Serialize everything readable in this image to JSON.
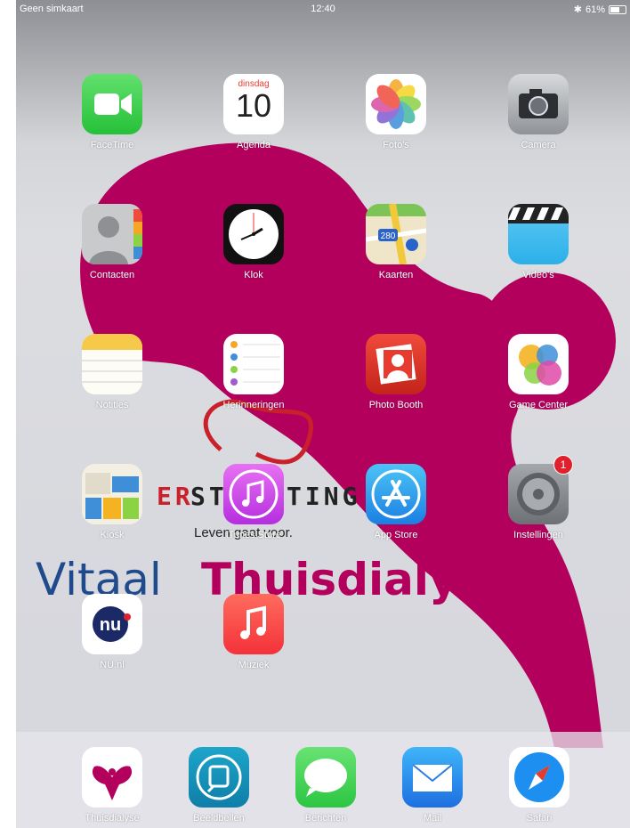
{
  "status_bar": {
    "carrier": "Geen simkaart",
    "time": "12:40",
    "battery": "61%"
  },
  "wallpaper": {
    "logo_word_left": "ER",
    "logo_word_mid": "ST",
    "logo_word_right": "TING",
    "slogan": "Leven gaat voor.",
    "headline_part1": "Vitaal",
    "headline_part2": "Thuisdialyse",
    "colors": {
      "magenta": "#b4005d",
      "blue": "#1f4a8c"
    }
  },
  "apps": [
    {
      "label": "FaceTime",
      "icon": "facetime-icon"
    },
    {
      "label": "Agenda",
      "icon": "calendar-icon",
      "day": "dinsdag",
      "date": "10"
    },
    {
      "label": "Foto's",
      "icon": "photos-icon"
    },
    {
      "label": "Camera",
      "icon": "camera-icon"
    },
    {
      "label": "Contacten",
      "icon": "contacts-icon"
    },
    {
      "label": "Klok",
      "icon": "clock-icon"
    },
    {
      "label": "Kaarten",
      "icon": "maps-icon",
      "sign": "280"
    },
    {
      "label": "Video's",
      "icon": "videos-icon"
    },
    {
      "label": "Notities",
      "icon": "notes-icon"
    },
    {
      "label": "Herinneringen",
      "icon": "reminders-icon"
    },
    {
      "label": "Photo Booth",
      "icon": "photo-booth-icon"
    },
    {
      "label": "Game Center",
      "icon": "game-center-icon"
    },
    {
      "label": "Kiosk",
      "icon": "kiosk-icon"
    },
    {
      "label": "iTunes Store",
      "icon": "itunes-store-icon"
    },
    {
      "label": "App Store",
      "icon": "app-store-icon"
    },
    {
      "label": "Instellingen",
      "icon": "settings-icon",
      "badge": "1"
    },
    {
      "label": "NU.nl",
      "icon": "nunl-icon",
      "text": "nu"
    },
    {
      "label": "Muziek",
      "icon": "music-icon"
    }
  ],
  "dock": [
    {
      "label": "Thuisdialyse",
      "icon": "thuisdialyse-icon"
    },
    {
      "label": "Beeldbellen",
      "icon": "beeldbellen-icon"
    },
    {
      "label": "Berichten",
      "icon": "messages-icon"
    },
    {
      "label": "Mail",
      "icon": "mail-icon"
    },
    {
      "label": "Safari",
      "icon": "safari-icon"
    }
  ]
}
